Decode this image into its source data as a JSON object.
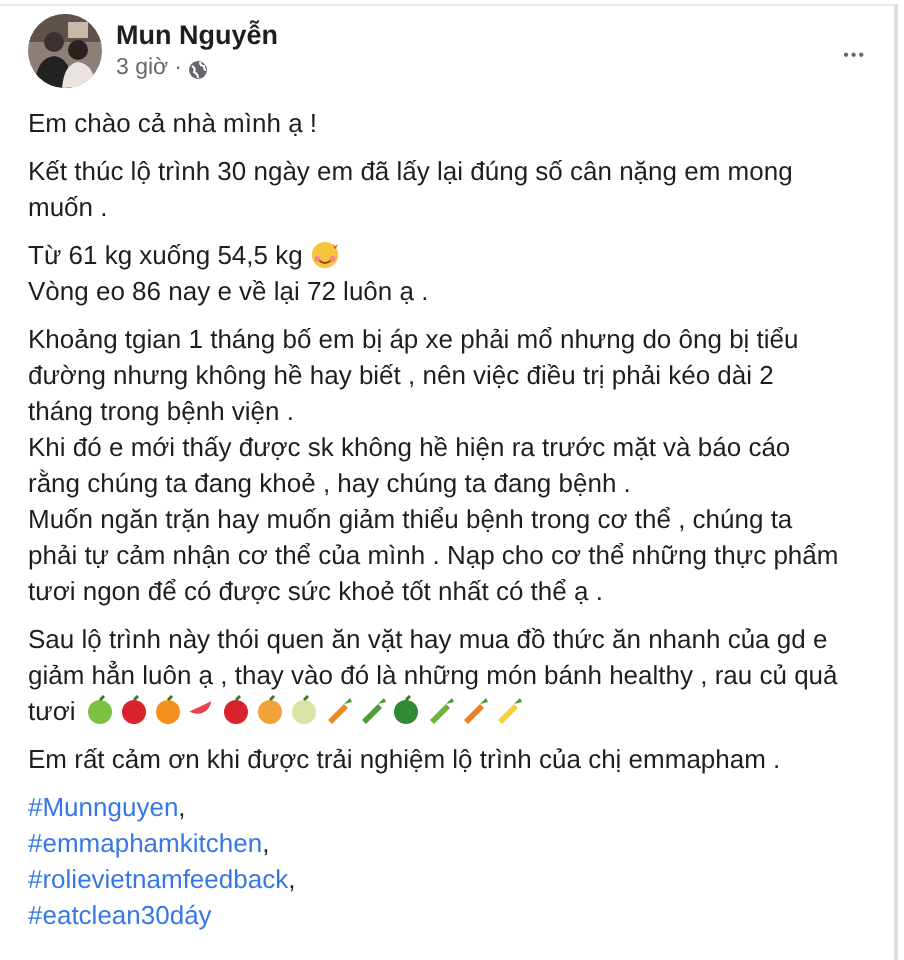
{
  "post": {
    "author": "Mun Nguyễn",
    "time": "3 giờ",
    "separator": "·",
    "more": "•••",
    "paragraphs": [
      {
        "lines": [
          {
            "text": "Em chào cả nhà mình ạ !",
            "kind": "plain"
          }
        ]
      },
      {
        "lines": [
          {
            "text": "Kết thúc lộ trình 30 ngày em đã lấy lại đúng số cân nặng em mong muốn .",
            "kind": "plain"
          }
        ]
      },
      {
        "lines": [
          {
            "text": "Từ 61 kg xuống 54,5 kg",
            "kind": "smiley"
          },
          {
            "text": "Vòng eo 86 nay e về lại 72 luôn ạ .",
            "kind": "plain"
          }
        ]
      },
      {
        "lines": [
          {
            "text": "Khoảng tgian 1 tháng bố em bị áp xe phải mổ nhưng do ông bị tiểu đường nhưng không hề hay biết , nên việc điều trị phải kéo dài 2 tháng trong bệnh viện .",
            "kind": "plain"
          },
          {
            "text": "Khi đó e mới thấy được sk không hề hiện ra trước mặt và báo cáo rằng chúng ta đang khoẻ , hay chúng ta đang bệnh .",
            "kind": "plain"
          },
          {
            "text": "Muốn ngăn trặn hay muốn giảm thiểu bệnh trong cơ thể , chúng ta phải tự cảm nhận cơ thể của mình . Nạp cho cơ thể những thực phẩm tươi ngon để có được sức khoẻ tốt nhất có thể ạ .",
            "kind": "plain"
          }
        ]
      },
      {
        "lines": [
          {
            "text": "Sau lộ trình này thói quen ăn vặt hay mua đồ thức ăn nhanh của gd e giảm hẳn luôn ạ , thay vào đó là những món bánh healthy , rau củ quả tươi",
            "kind": "fruits"
          }
        ]
      },
      {
        "lines": [
          {
            "text": "Em rất cảm ơn khi được trải nghiệm lộ trình của chị emmapham .",
            "kind": "plain"
          }
        ]
      }
    ],
    "hashtags": [
      {
        "tag": "#Munnguyen",
        "suffix": ","
      },
      {
        "tag": "#emmaphamkitchen",
        "suffix": ","
      },
      {
        "tag": "#rolievietnamfeedback",
        "suffix": ","
      },
      {
        "tag": "#eatclean30dáy"
      }
    ]
  }
}
